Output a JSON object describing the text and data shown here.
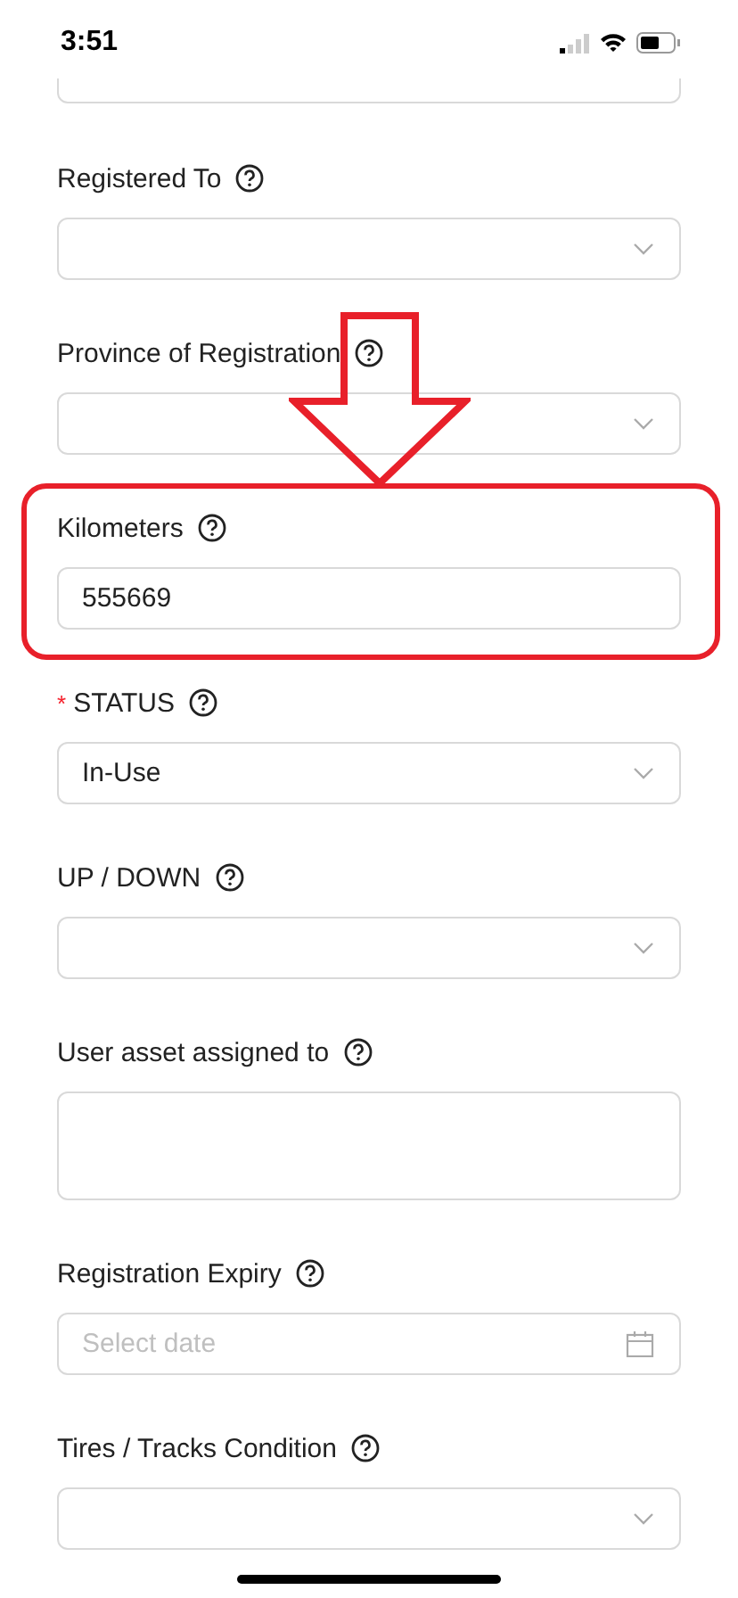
{
  "status_bar": {
    "time": "3:51"
  },
  "fields": [
    {
      "kind": "cut"
    },
    {
      "kind": "select",
      "label": "Registered To",
      "required": false,
      "highlighted": false
    },
    {
      "kind": "select",
      "label": "Province of Registration",
      "required": false,
      "highlighted": false
    },
    {
      "kind": "text",
      "label": "Kilometers",
      "required": false,
      "value": "555669",
      "highlighted": true
    },
    {
      "kind": "select",
      "label": "STATUS",
      "required": true,
      "required_mark": "*",
      "value": "In-Use",
      "highlighted": false
    },
    {
      "kind": "select",
      "label": "UP / DOWN",
      "required": false,
      "highlighted": false
    },
    {
      "kind": "textarea",
      "label": "User asset assigned to",
      "required": false,
      "highlighted": false
    },
    {
      "kind": "date",
      "label": "Registration Expiry",
      "required": false,
      "placeholder": "Select date",
      "highlighted": false
    },
    {
      "kind": "select",
      "label": "Tires / Tracks Condition",
      "required": false,
      "highlighted": false
    }
  ]
}
